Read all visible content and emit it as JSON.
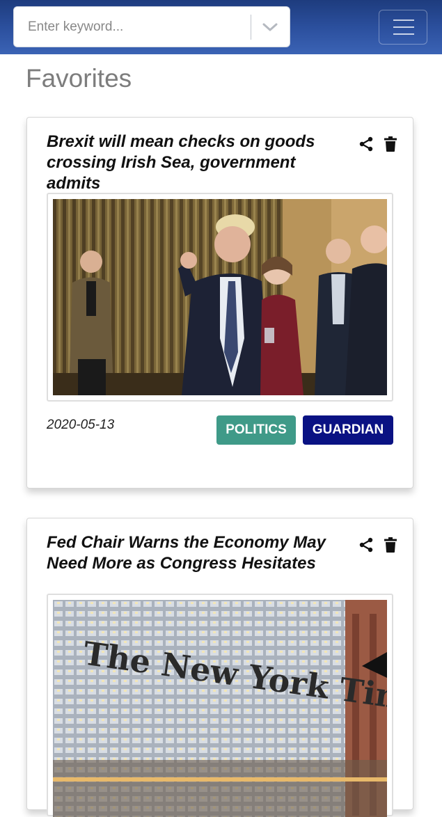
{
  "search": {
    "placeholder": "Enter keyword..."
  },
  "page": {
    "title": "Favorites"
  },
  "articles": [
    {
      "title": "Brexit will mean checks on goods crossing Irish Sea, government admits",
      "date": "2020-05-13",
      "section": "POLITICS",
      "source": "GUARDIAN"
    },
    {
      "title": "Fed Chair Warns the Economy May Need More as Congress Hesitates",
      "image_text": "The New York Times"
    }
  ],
  "colors": {
    "navbar": "#2b4f9d",
    "badge_politics": "#3f9a88",
    "badge_guardian": "#0a1283"
  },
  "icons": [
    "chevron-down-icon",
    "hamburger-menu-icon",
    "share-icon",
    "trash-icon"
  ]
}
